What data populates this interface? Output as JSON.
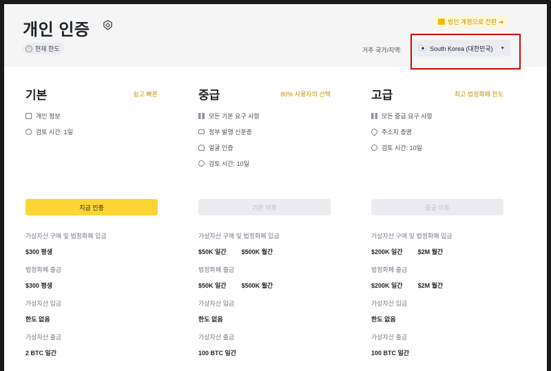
{
  "header": {
    "title": "개인 인증",
    "current_limit": "현재 한도",
    "corporate_button": "법인 계정으로 전환 ➔",
    "country_label": "거주 국가/지역:",
    "country_value": "South Korea (대한민국)"
  },
  "tiers": [
    {
      "title": "기본",
      "tag": "쉽고 빠른",
      "requirements": [
        {
          "icon": "id-card-icon",
          "text": "개인 정보"
        },
        {
          "icon": "clock-icon",
          "text": "검토 시간: 1일"
        }
      ],
      "button": "지금 인증",
      "limits": [
        {
          "label": "가상자산 구매 및 법정화폐 입금",
          "values": [
            "$300 평생"
          ]
        },
        {
          "label": "법정화폐 출금",
          "values": [
            "$300 평생"
          ]
        },
        {
          "label": "가상자산 입금",
          "values": [
            "한도 없음"
          ]
        },
        {
          "label": "가상자산 출금",
          "values": [
            "2 BTC 일간"
          ]
        }
      ]
    },
    {
      "title": "중급",
      "tag": "80% 사용자의 선택",
      "requirements": [
        {
          "icon": "grid-icon",
          "text": "모든 기본 요구 사항"
        },
        {
          "icon": "card-icon",
          "text": "정부 발행 신분증"
        },
        {
          "icon": "face-icon",
          "text": "얼굴 인증"
        },
        {
          "icon": "clock-icon",
          "text": "검토 시간: 10일"
        }
      ],
      "button": "기본 이후",
      "limits": [
        {
          "label": "가상자산 구매 및 법정화폐 입금",
          "values": [
            "$50K 일간",
            "$500K 월간"
          ]
        },
        {
          "label": "법정화폐 출금",
          "values": [
            "$50K 일간",
            "$500K 월간"
          ]
        },
        {
          "label": "가상자산 입금",
          "values": [
            "한도 없음"
          ]
        },
        {
          "label": "가상자산 출금",
          "values": [
            "100 BTC 일간"
          ]
        }
      ]
    },
    {
      "title": "고급",
      "tag": "최고 법정화폐 한도",
      "requirements": [
        {
          "icon": "grid-icon",
          "text": "모든 중급 요구 사항"
        },
        {
          "icon": "location-pin-icon",
          "text": "주소지 증명"
        },
        {
          "icon": "clock-icon",
          "text": "검토 시간: 10일"
        }
      ],
      "button": "중급 이후",
      "limits": [
        {
          "label": "가상자산 구매 및 법정화폐 입금",
          "values": [
            "$200K 일간",
            "$2M 월간"
          ]
        },
        {
          "label": "법정화폐 출금",
          "values": [
            "$200K 일간",
            "$2M 월간"
          ]
        },
        {
          "label": "가상자산 입금",
          "values": [
            "한도 없음"
          ]
        },
        {
          "label": "가상자산 출금",
          "values": [
            "100 BTC 일간"
          ]
        }
      ]
    }
  ]
}
